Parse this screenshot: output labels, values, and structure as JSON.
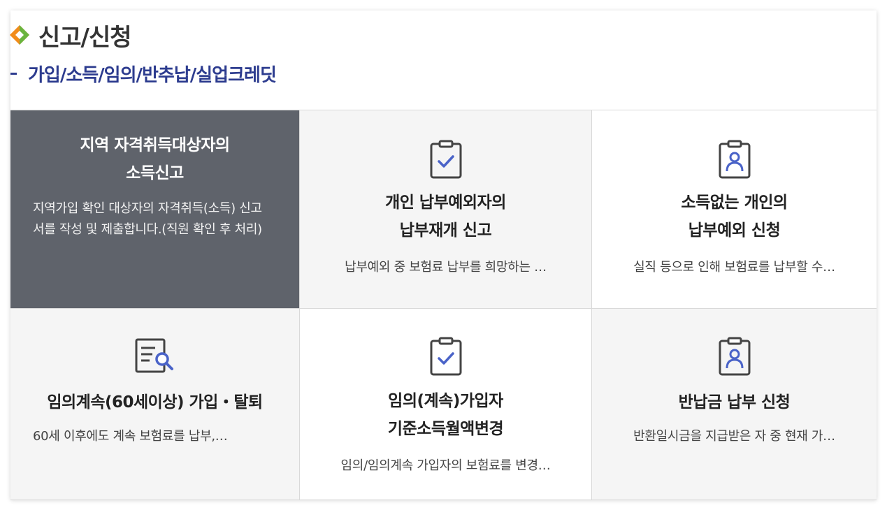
{
  "header": {
    "title": "신고/신청",
    "subtitle": "가입/소득/임의/반추납/실업크레딧",
    "accent_colors": [
      "#f28c1b",
      "#6ab43e"
    ],
    "subtitle_color": "#2d3c8f"
  },
  "cards": [
    {
      "title_line1": "지역 자격취득대상자의",
      "title_line2": "소득신고",
      "description": "지역가입 확인 대상자의 자격취득(소득) 신고서를 작성 및 제출합니다.(직원 확인 후 처리)",
      "state": "selected",
      "icon": "none"
    },
    {
      "title_line1": "개인 납부예외자의",
      "title_line2": "납부재개 신고",
      "description": "납부예외 중 보험료 납부를 희망하는 …",
      "icon": "clipboard-check-icon"
    },
    {
      "title_line1": "소득없는 개인의",
      "title_line2": "납부예외 신청",
      "description": "실직 등으로 인해 보험료를 납부할 수…",
      "icon": "id-badge-icon"
    },
    {
      "title_line1": "임의계속(60세이상) 가입・탈퇴",
      "title_line2": "",
      "description": "60세 이후에도 계속 보험료를 납부,…",
      "icon": "document-search-icon"
    },
    {
      "title_line1": "임의(계속)가입자",
      "title_line2": "기준소득월액변경",
      "description": "임의/임의계속 가입자의 보험료를 변경…",
      "icon": "clipboard-check-icon"
    },
    {
      "title_line1": "반납금 납부 신청",
      "title_line2": "",
      "description": "반환일시금을 지급받은 자 중 현재 가…",
      "icon": "id-badge-icon"
    }
  ]
}
